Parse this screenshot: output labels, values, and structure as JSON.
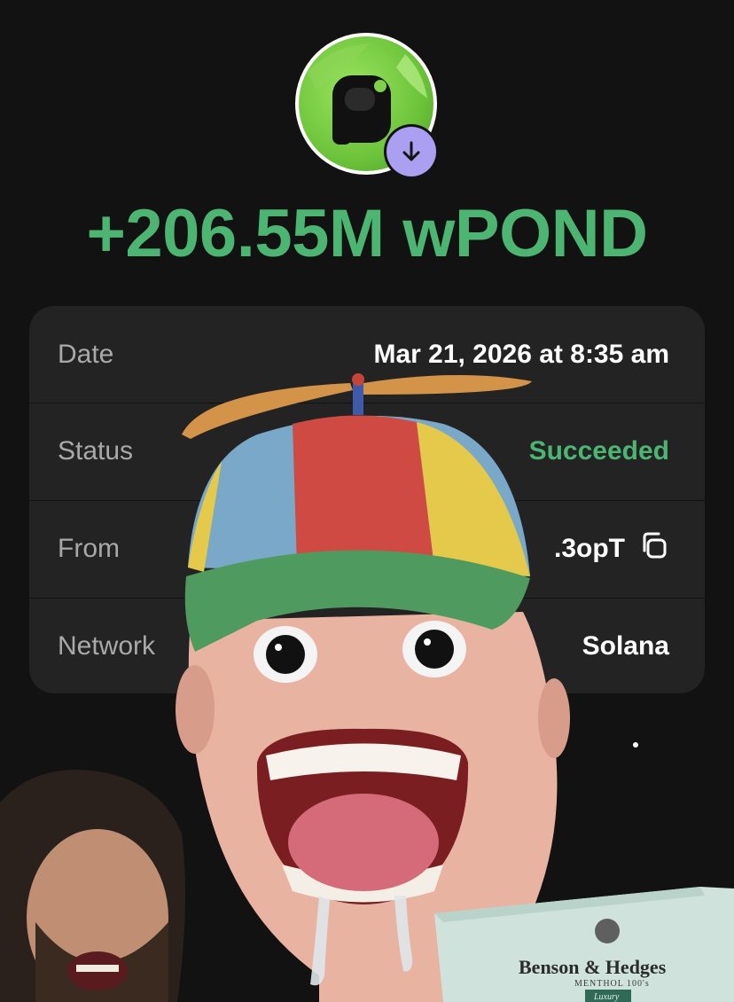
{
  "token": {
    "icon": "pond-logo",
    "badge_icon": "arrow-down-icon",
    "accent": "#ab9ff2"
  },
  "amount": {
    "text": "+206.55M wPOND",
    "color": "#4cb572"
  },
  "details": {
    "rows": [
      {
        "label": "Date",
        "value": "Mar 21, 2026 at 8:35 am"
      },
      {
        "label": "Status",
        "value": "Succeeded",
        "value_color": "#4cb572"
      },
      {
        "label": "From",
        "value": ".3opT",
        "icon": "copy-icon"
      },
      {
        "label": "Network",
        "value": "Solana"
      }
    ]
  },
  "overlay": {
    "box": {
      "brand_left": "Benson",
      "amp": "&",
      "brand_right": "Hedges",
      "sub": "MENTHOL 100's",
      "badge": "Luxury"
    }
  }
}
